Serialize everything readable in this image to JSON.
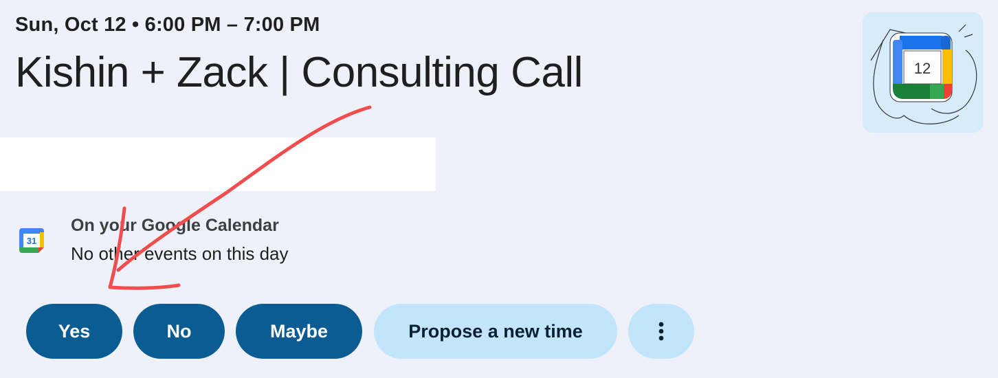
{
  "event": {
    "datetime": "Sun, Oct 12 • 6:00 PM – 7:00 PM",
    "title": "Kishin + Zack | Consulting Call"
  },
  "illustration": {
    "icon": "calendar-12-illustration",
    "day_number": "12"
  },
  "calendar_info": {
    "icon": "google-calendar-icon",
    "icon_day": "31",
    "heading": "On your Google Calendar",
    "subtext": "No other events on this day"
  },
  "rsvp": {
    "yes": "Yes",
    "no": "No",
    "maybe": "Maybe",
    "propose": "Propose a new time",
    "more_icon": "more-vertical-icon"
  },
  "colors": {
    "background": "#eef1f9",
    "primary_button": "#0b5c93",
    "secondary_button": "#c2e5fb",
    "annotation_arrow": "#f04e4e"
  }
}
